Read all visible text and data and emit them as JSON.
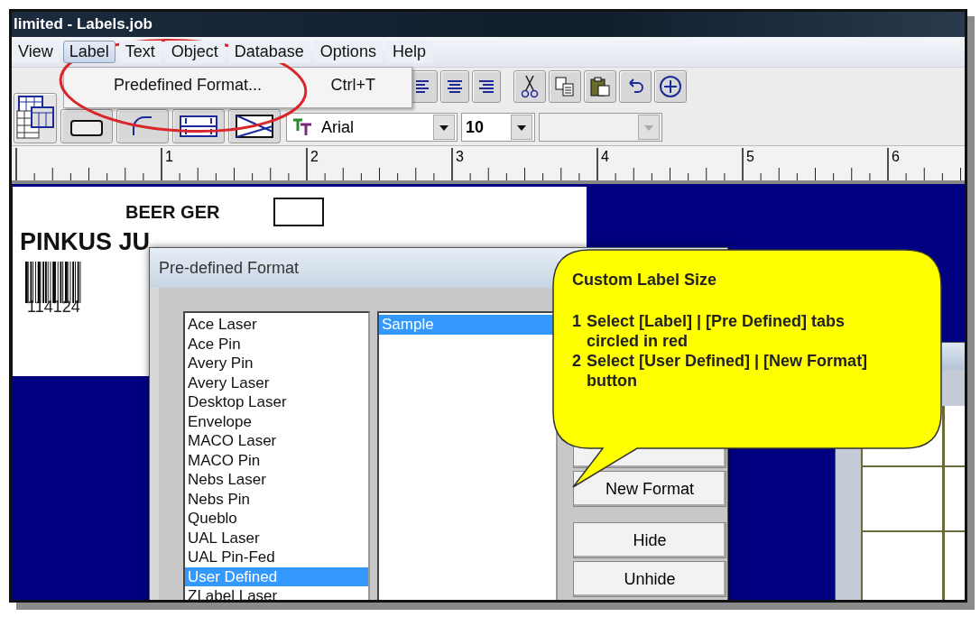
{
  "window": {
    "title": "limited - Labels.job"
  },
  "menu": [
    {
      "label": "View",
      "selected": false
    },
    {
      "label": "Label",
      "selected": true
    },
    {
      "label": "Text",
      "selected": false
    },
    {
      "label": "Object",
      "selected": false
    },
    {
      "label": "Database",
      "selected": false
    },
    {
      "label": "Options",
      "selected": false
    },
    {
      "label": "Help",
      "selected": false
    }
  ],
  "open_menu": {
    "items": [
      {
        "label": "Predefined Format...",
        "shortcut": "Ctrl+T"
      }
    ]
  },
  "toolbar": {
    "font": "Arial",
    "size": "10"
  },
  "ruler": {
    "marks": [
      "1",
      "2",
      "3",
      "4",
      "5",
      "6"
    ]
  },
  "label_design": {
    "heading": "BEER GER",
    "title": "PINKUS JU",
    "barcode_number": "114124"
  },
  "dialog": {
    "title": "Pre-defined Format",
    "formats": [
      {
        "label": "Ace Laser",
        "selected": false
      },
      {
        "label": "Ace Pin",
        "selected": false
      },
      {
        "label": "Avery Pin",
        "selected": false
      },
      {
        "label": "Avery Laser",
        "selected": false
      },
      {
        "label": "Desktop Laser",
        "selected": false
      },
      {
        "label": "Envelope",
        "selected": false
      },
      {
        "label": "MACO Laser",
        "selected": false
      },
      {
        "label": "MACO Pin",
        "selected": false
      },
      {
        "label": "Nebs Laser",
        "selected": false
      },
      {
        "label": "Nebs Pin",
        "selected": false
      },
      {
        "label": "Queblo",
        "selected": false
      },
      {
        "label": "UAL Laser",
        "selected": false
      },
      {
        "label": "UAL Pin-Fed",
        "selected": false
      },
      {
        "label": "User Defined",
        "selected": true
      },
      {
        "label": "ZLabel Laser",
        "selected": false
      }
    ],
    "layouts": [
      {
        "label": "Sample",
        "selected": true
      }
    ],
    "buttons": [
      {
        "label": "New Format"
      },
      {
        "label": "Hide"
      },
      {
        "label": "Unhide"
      }
    ]
  },
  "callout": {
    "title": "Custom Label Size",
    "steps": [
      {
        "number": "1",
        "text": "Select [Label] | [Pre Defined] tabs circled in red"
      },
      {
        "number": "2",
        "text": "Select [User Defined] | [New Format] button"
      }
    ]
  }
}
